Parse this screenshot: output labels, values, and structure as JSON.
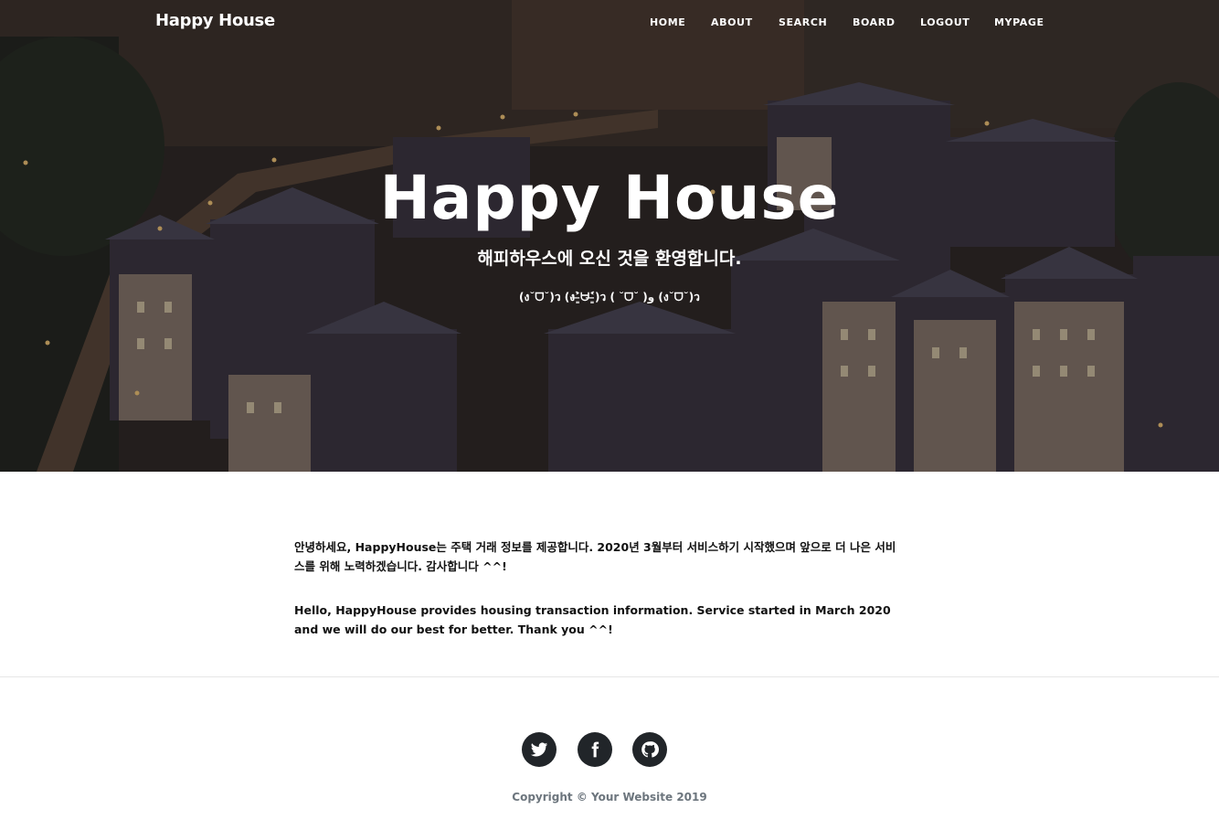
{
  "nav": {
    "brand": "Happy House",
    "links": [
      {
        "label": "HOME"
      },
      {
        "label": "ABOUT"
      },
      {
        "label": "SEARCH"
      },
      {
        "label": "BOARD"
      },
      {
        "label": "LOGOUT"
      },
      {
        "label": "MYPAGE"
      }
    ]
  },
  "hero": {
    "title": "Happy House",
    "subtitle": "해피하우스에 오신 것을 환영합니다.",
    "emoticons": "(ง˘ᗜ˘)ว (ง˃̶͈̀ᗨ˂̶͈́)ว ( ˘ᗜ˘ )و (ง˘ᗜ˘)ว",
    "background": "night-town-photo"
  },
  "about": {
    "korean": "안녕하세요, HappyHouse는 주택 거래 정보를 제공합니다. 2020년 3월부터 서비스하기 시작했으며 앞으로 더 나은 서비스를 위해 노력하겠습니다. 감사합니다 ^^!",
    "english": "Hello, HappyHouse provides housing transaction information. Service started in March 2020 and we will do our best for better. Thank you ^^!"
  },
  "footer": {
    "social": [
      {
        "icon": "twitter-icon"
      },
      {
        "icon": "facebook-icon"
      },
      {
        "icon": "github-icon"
      }
    ],
    "copyright": "Copyright © Your Website 2019"
  },
  "colors": {
    "social_bg": "#212529",
    "copyright": "#6c757d",
    "nav_text": "#ffffff"
  }
}
